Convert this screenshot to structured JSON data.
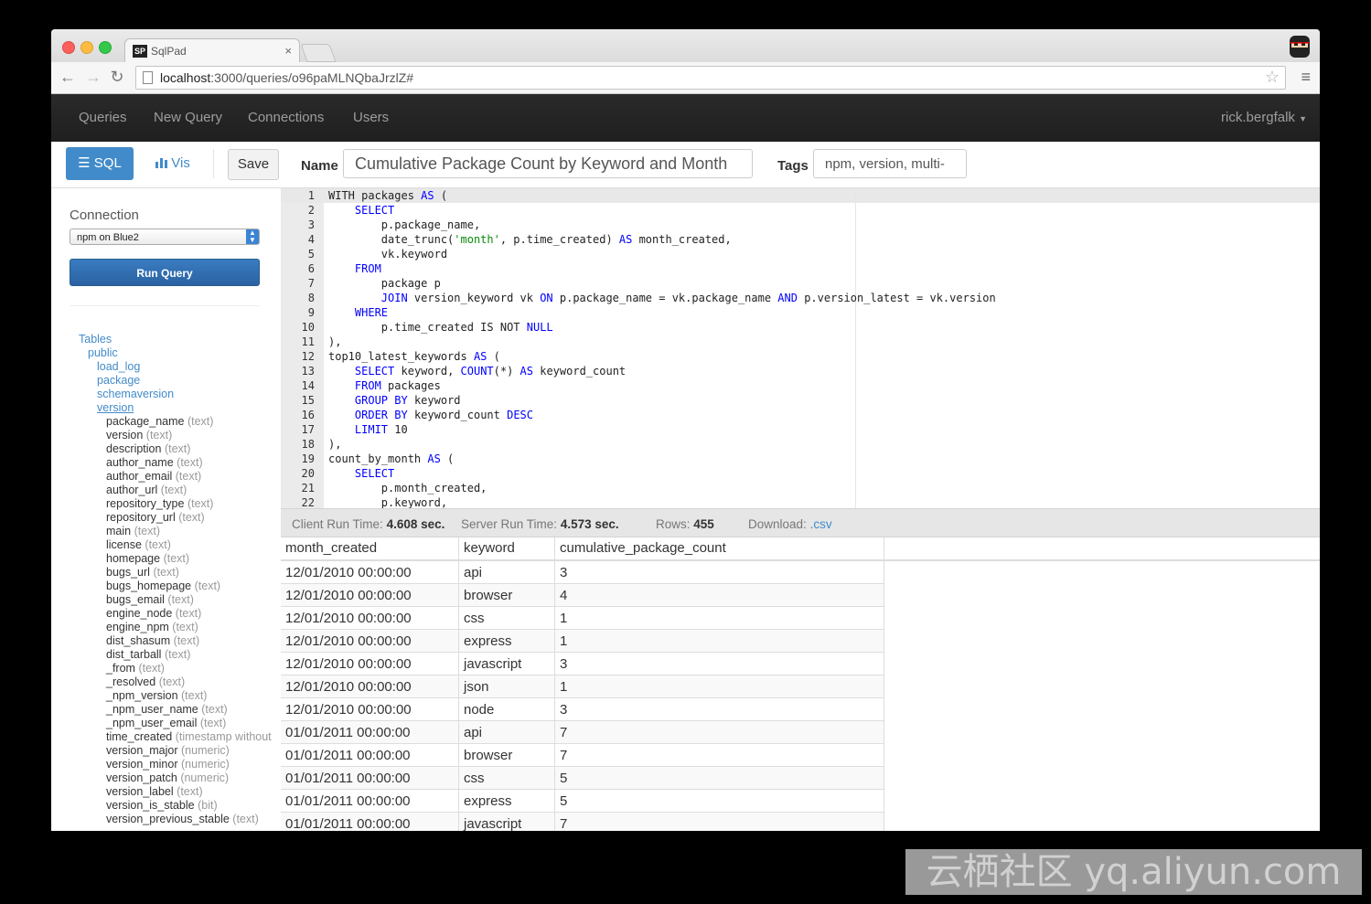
{
  "browser": {
    "tab_title": "SqlPad",
    "tab_icon_text": "SP",
    "tab_close": "×",
    "url_host": "localhost",
    "url_path": ":3000/queries/o96paMLNQbaJrzlZ#",
    "back": "←",
    "forward": "→",
    "reload": "↻",
    "star": "☆",
    "menu": "≡"
  },
  "nav": {
    "items": [
      "Queries",
      "New Query",
      "Connections",
      "Users"
    ],
    "user": "rick.bergfalk"
  },
  "query_toolbar": {
    "sql_label": "SQL",
    "vis_label": "Vis",
    "save_label": "Save",
    "name_label": "Name",
    "name_value": "Cumulative Package Count by Keyword and Month",
    "tags_label": "Tags",
    "tags_value": "npm, version, multi-"
  },
  "sidebar": {
    "connection_label": "Connection",
    "connection_value": "npm on Blue2",
    "run_label": "Run Query",
    "tree_root": "Tables",
    "schema": "public",
    "tables": [
      "load_log",
      "package",
      "schemaversion",
      "version"
    ],
    "columns": [
      {
        "name": "package_name",
        "type": "(text)"
      },
      {
        "name": "version",
        "type": "(text)"
      },
      {
        "name": "description",
        "type": "(text)"
      },
      {
        "name": "author_name",
        "type": "(text)"
      },
      {
        "name": "author_email",
        "type": "(text)"
      },
      {
        "name": "author_url",
        "type": "(text)"
      },
      {
        "name": "repository_type",
        "type": "(text)"
      },
      {
        "name": "repository_url",
        "type": "(text)"
      },
      {
        "name": "main",
        "type": "(text)"
      },
      {
        "name": "license",
        "type": "(text)"
      },
      {
        "name": "homepage",
        "type": "(text)"
      },
      {
        "name": "bugs_url",
        "type": "(text)"
      },
      {
        "name": "bugs_homepage",
        "type": "(text)"
      },
      {
        "name": "bugs_email",
        "type": "(text)"
      },
      {
        "name": "engine_node",
        "type": "(text)"
      },
      {
        "name": "engine_npm",
        "type": "(text)"
      },
      {
        "name": "dist_shasum",
        "type": "(text)"
      },
      {
        "name": "dist_tarball",
        "type": "(text)"
      },
      {
        "name": "_from",
        "type": "(text)"
      },
      {
        "name": "_resolved",
        "type": "(text)"
      },
      {
        "name": "_npm_version",
        "type": "(text)"
      },
      {
        "name": "_npm_user_name",
        "type": "(text)"
      },
      {
        "name": "_npm_user_email",
        "type": "(text)"
      },
      {
        "name": "time_created",
        "type": "(timestamp without"
      },
      {
        "name": "version_major",
        "type": "(numeric)"
      },
      {
        "name": "version_minor",
        "type": "(numeric)"
      },
      {
        "name": "version_patch",
        "type": "(numeric)"
      },
      {
        "name": "version_label",
        "type": "(text)"
      },
      {
        "name": "version_is_stable",
        "type": "(bit)"
      },
      {
        "name": "version_previous_stable",
        "type": "(text)"
      }
    ]
  },
  "editor": {
    "lines": [
      "WITH packages AS (",
      "    SELECT",
      "        p.package_name,",
      "        date_trunc('month', p.time_created) AS month_created,",
      "        vk.keyword",
      "    FROM",
      "        package p",
      "        JOIN version_keyword vk ON p.package_name = vk.package_name AND p.version_latest = vk.version",
      "    WHERE",
      "        p.time_created IS NOT NULL",
      "),",
      "top10_latest_keywords AS (",
      "    SELECT keyword, COUNT(*) AS keyword_count",
      "    FROM packages",
      "    GROUP BY keyword",
      "    ORDER BY keyword_count DESC",
      "    LIMIT 10",
      "),",
      "count_by_month AS (",
      "    SELECT",
      "        p.month_created,",
      "        p.keyword,"
    ]
  },
  "status": {
    "client_label": "Client Run Time:",
    "client_value": "4.608 sec.",
    "server_label": "Server Run Time:",
    "server_value": "4.573 sec.",
    "rows_label": "Rows:",
    "rows_value": "455",
    "download_label": "Download:",
    "download_link": ".csv"
  },
  "results": {
    "columns": [
      "month_created",
      "keyword",
      "cumulative_package_count"
    ],
    "rows": [
      [
        "12/01/2010 00:00:00",
        "api",
        "3"
      ],
      [
        "12/01/2010 00:00:00",
        "browser",
        "4"
      ],
      [
        "12/01/2010 00:00:00",
        "css",
        "1"
      ],
      [
        "12/01/2010 00:00:00",
        "express",
        "1"
      ],
      [
        "12/01/2010 00:00:00",
        "javascript",
        "3"
      ],
      [
        "12/01/2010 00:00:00",
        "json",
        "1"
      ],
      [
        "12/01/2010 00:00:00",
        "node",
        "3"
      ],
      [
        "01/01/2011 00:00:00",
        "api",
        "7"
      ],
      [
        "01/01/2011 00:00:00",
        "browser",
        "7"
      ],
      [
        "01/01/2011 00:00:00",
        "css",
        "5"
      ],
      [
        "01/01/2011 00:00:00",
        "express",
        "5"
      ],
      [
        "01/01/2011 00:00:00",
        "javascript",
        "7"
      ]
    ]
  },
  "watermark": "云栖社区 yq.aliyun.com"
}
